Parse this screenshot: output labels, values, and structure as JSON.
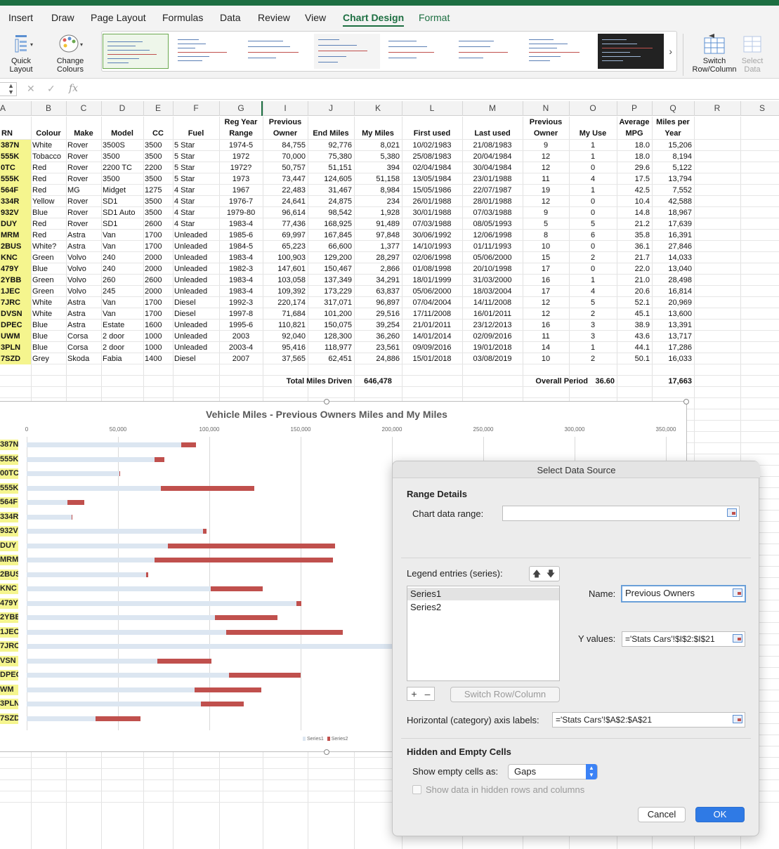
{
  "ribbon": {
    "tabs": [
      "Insert",
      "Draw",
      "Page Layout",
      "Formulas",
      "Data",
      "Review",
      "View",
      "Chart Design",
      "Format"
    ],
    "quick_layout": "Quick Layout",
    "quick_layout_1": "Quick",
    "quick_layout_2": "Layout",
    "change_colours_1": "Change",
    "change_colours_2": "Colours",
    "switch_1": "Switch",
    "switch_2": "Row/Column",
    "select_1": "Select",
    "select_2": "Data"
  },
  "formula_bar": {
    "fx": "fx",
    "cancel": "✕",
    "enter": "✓"
  },
  "columns": [
    "A",
    "B",
    "C",
    "D",
    "E",
    "F",
    "G",
    "I",
    "J",
    "K",
    "L",
    "M",
    "N",
    "O",
    "P",
    "Q",
    "R",
    "S"
  ],
  "table": {
    "headers_top": {
      "g": "Reg Year",
      "i": "Previous",
      "n": "Previous",
      "p": "Average",
      "q": "Miles per"
    },
    "headers": {
      "a": "RN",
      "b": "Colour",
      "c": "Make",
      "d": "Model",
      "e": "CC",
      "f": "Fuel",
      "g": "Range",
      "i": "Owner",
      "j": "End Miles",
      "k": "My Miles",
      "l": "First used",
      "m": "Last used",
      "n": "Owner",
      "o": "My Use",
      "p": "MPG",
      "q": "Year"
    },
    "rows": [
      [
        "387N",
        "White",
        "Rover",
        "3500S",
        "3500",
        "5 Star",
        "1974-5",
        "84,755",
        "92,776",
        "8,021",
        "10/02/1983",
        "21/08/1983",
        "9",
        "1",
        "18.0",
        "15,206"
      ],
      [
        "555K",
        "Tobacco",
        "Rover",
        "3500",
        "3500",
        "5 Star",
        "1972",
        "70,000",
        "75,380",
        "5,380",
        "25/08/1983",
        "20/04/1984",
        "12",
        "1",
        "18.0",
        "8,194"
      ],
      [
        "0TC",
        "Red",
        "Rover",
        "2200 TC",
        "2200",
        "5 Star",
        "1972?",
        "50,757",
        "51,151",
        "394",
        "02/04/1984",
        "30/04/1984",
        "12",
        "0",
        "29.6",
        "5,122"
      ],
      [
        "555K",
        "Red",
        "Rover",
        "3500",
        "3500",
        "5 Star",
        "1973",
        "73,447",
        "124,605",
        "51,158",
        "13/05/1984",
        "23/01/1988",
        "11",
        "4",
        "17.5",
        "13,794"
      ],
      [
        "564F",
        "Red",
        "MG",
        "Midget",
        "1275",
        "4 Star",
        "1967",
        "22,483",
        "31,467",
        "8,984",
        "15/05/1986",
        "22/07/1987",
        "19",
        "1",
        "42.5",
        "7,552"
      ],
      [
        "334R",
        "Yellow",
        "Rover",
        "SD1",
        "3500",
        "4 Star",
        "1976-7",
        "24,641",
        "24,875",
        "234",
        "26/01/1988",
        "28/01/1988",
        "12",
        "0",
        "10.4",
        "42,588"
      ],
      [
        "932V",
        "Blue",
        "Rover",
        "SD1 Auto",
        "3500",
        "4 Star",
        "1979-80",
        "96,614",
        "98,542",
        "1,928",
        "30/01/1988",
        "07/03/1988",
        "9",
        "0",
        "14.8",
        "18,967"
      ],
      [
        "DUY",
        "Red",
        "Rover",
        "SD1",
        "2600",
        "4 Star",
        "1983-4",
        "77,436",
        "168,925",
        "91,489",
        "07/03/1988",
        "08/05/1993",
        "5",
        "5",
        "21.2",
        "17,639"
      ],
      [
        "MRM",
        "Red",
        "Astra",
        "Van",
        "1700",
        "Unleaded",
        "1985-6",
        "69,997",
        "167,845",
        "97,848",
        "30/06/1992",
        "12/06/1998",
        "8",
        "6",
        "35.8",
        "16,391"
      ],
      [
        "2BUS",
        "White?",
        "Astra",
        "Van",
        "1700",
        "Unleaded",
        "1984-5",
        "65,223",
        "66,600",
        "1,377",
        "14/10/1993",
        "01/11/1993",
        "10",
        "0",
        "36.1",
        "27,846"
      ],
      [
        "KNC",
        "Green",
        "Volvo",
        "240",
        "2000",
        "Unleaded",
        "1983-4",
        "100,903",
        "129,200",
        "28,297",
        "02/06/1998",
        "05/06/2000",
        "15",
        "2",
        "21.7",
        "14,033"
      ],
      [
        "479Y",
        "Blue",
        "Volvo",
        "240",
        "2000",
        "Unleaded",
        "1982-3",
        "147,601",
        "150,467",
        "2,866",
        "01/08/1998",
        "20/10/1998",
        "17",
        "0",
        "22.0",
        "13,040"
      ],
      [
        "2YBB",
        "Green",
        "Volvo",
        "260",
        "2600",
        "Unleaded",
        "1983-4",
        "103,058",
        "137,349",
        "34,291",
        "18/01/1999",
        "31/03/2000",
        "16",
        "1",
        "21.0",
        "28,498"
      ],
      [
        "1JEC",
        "Green",
        "Volvo",
        "245",
        "2000",
        "Unleaded",
        "1983-4",
        "109,392",
        "173,229",
        "63,837",
        "05/06/2000",
        "18/03/2004",
        "17",
        "4",
        "20.6",
        "16,814"
      ],
      [
        "7JRC",
        "White",
        "Astra",
        "Van",
        "1700",
        "Diesel",
        "1992-3",
        "220,174",
        "317,071",
        "96,897",
        "07/04/2004",
        "14/11/2008",
        "12",
        "5",
        "52.1",
        "20,969"
      ],
      [
        "DVSN",
        "White",
        "Astra",
        "Van",
        "1700",
        "Diesel",
        "1997-8",
        "71,684",
        "101,200",
        "29,516",
        "17/11/2008",
        "16/01/2011",
        "12",
        "2",
        "45.1",
        "13,600"
      ],
      [
        "DPEC",
        "Blue",
        "Astra",
        "Estate",
        "1600",
        "Unleaded",
        "1995-6",
        "110,821",
        "150,075",
        "39,254",
        "21/01/2011",
        "23/12/2013",
        "16",
        "3",
        "38.9",
        "13,391"
      ],
      [
        "UWM",
        "Blue",
        "Corsa",
        "2 door",
        "1000",
        "Unleaded",
        "2003",
        "92,040",
        "128,300",
        "36,260",
        "14/01/2014",
        "02/09/2016",
        "11",
        "3",
        "43.6",
        "13,717"
      ],
      [
        "3PLN",
        "Blue",
        "Corsa",
        "2 door",
        "1000",
        "Unleaded",
        "2003-4",
        "95,416",
        "118,977",
        "23,561",
        "09/09/2016",
        "19/01/2018",
        "14",
        "1",
        "44.1",
        "17,286"
      ],
      [
        "7SZD",
        "Grey",
        "Skoda",
        "Fabia",
        "1400",
        "Diesel",
        "2007",
        "37,565",
        "62,451",
        "24,886",
        "15/01/2018",
        "03/08/2019",
        "10",
        "2",
        "50.1",
        "16,033"
      ]
    ],
    "total_label": "Total Miles Driven",
    "total_value": "646,478",
    "overall_label": "Overall Period",
    "overall_value": "36.60",
    "miles_per_year_total": "17,663"
  },
  "chart_data": {
    "type": "bar",
    "title": "Vehicle Miles -  Previous Owners Miles and My Miles",
    "xlim": [
      0,
      350000
    ],
    "xticks": [
      "0",
      "50,000",
      "100,000",
      "150,000",
      "200,000",
      "250,000",
      "300,000",
      "350,000"
    ],
    "categories": [
      "387N",
      "555K",
      "00TC",
      "555K",
      "564F",
      "334R",
      "932V",
      "DUY",
      "MRM",
      "2BUS",
      "KNC",
      "479Y",
      "2YBB",
      "1JEC",
      "7JRC",
      "VSN",
      "DPEC",
      "WM",
      "3PLN",
      "7SZD"
    ],
    "series": [
      {
        "name": "Series1",
        "color": "#dce6f1",
        "values": [
          84755,
          70000,
          50757,
          73447,
          22483,
          24641,
          96614,
          77436,
          69997,
          65223,
          100903,
          147601,
          103058,
          109392,
          220174,
          71684,
          110821,
          92040,
          95416,
          37565
        ]
      },
      {
        "name": "Series2",
        "color": "#c0504d",
        "values": [
          8021,
          5380,
          394,
          51158,
          8984,
          234,
          1928,
          91489,
          97848,
          1377,
          28297,
          2866,
          34291,
          63837,
          96897,
          29516,
          39254,
          36260,
          23561,
          24886
        ]
      }
    ],
    "stacked": true,
    "legend_position": "bottom"
  },
  "dialog": {
    "title": "Select Data Source",
    "range_details": "Range Details",
    "chart_data_range_label": "Chart data range:",
    "chart_data_range_value": "",
    "legend_entries_label": "Legend entries (series):",
    "series_list": [
      "Series1",
      "Series2"
    ],
    "name_label": "Name:",
    "name_value": "Previous Owners",
    "y_values_label": "Y values:",
    "y_values_value": "='Stats Cars'!$I$2:$I$21",
    "switch_row_column": "Switch Row/Column",
    "category_axis_label": "Horizontal (category) axis labels:",
    "category_axis_value": "='Stats Cars'!$A$2:$A$21",
    "hidden_empty_cells": "Hidden and Empty Cells",
    "show_empty_label": "Show empty cells as:",
    "show_empty_value": "Gaps",
    "show_hidden_label": "Show data in hidden rows and columns",
    "cancel": "Cancel",
    "ok": "OK",
    "up": "🡅",
    "down": "🡇",
    "plus": "+",
    "minus": "–"
  }
}
